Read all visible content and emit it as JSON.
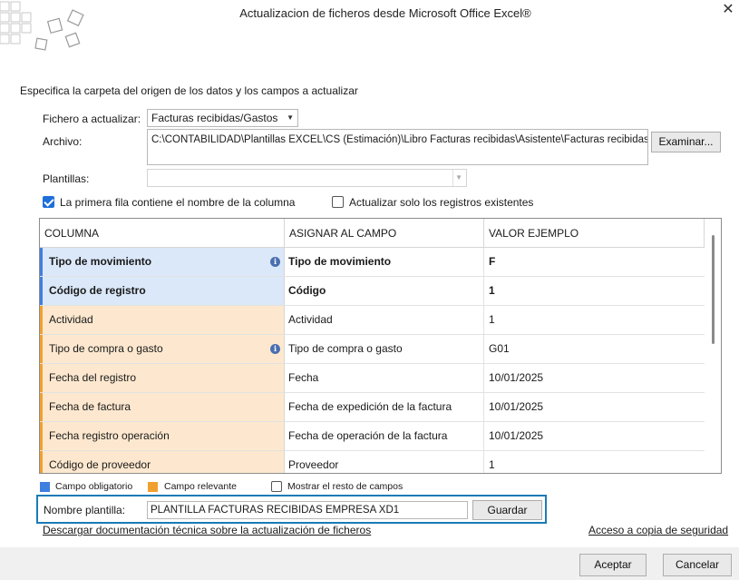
{
  "window": {
    "title": "Actualizacion de ficheros desde Microsoft Office Excel®",
    "close_icon": "close-icon"
  },
  "header": {
    "instruction": "Especifica la carpeta del origen de los datos y los campos a actualizar"
  },
  "form": {
    "fichero_label": "Fichero a actualizar:",
    "fichero_value": "Facturas recibidas/Gastos",
    "archivo_label": "Archivo:",
    "archivo_value": "C:\\CONTABILIDAD\\Plantillas EXCEL\\CS (Estimación)\\Libro Facturas recibidas\\Asistente\\Facturas recibidas asis",
    "examinar_label": "Examinar...",
    "plantillas_label": "Plantillas:",
    "plantillas_value": "",
    "primera_fila_label": "La primera fila contiene el nombre de la columna",
    "primera_fila_checked": true,
    "actualizar_label": "Actualizar solo los registros existentes",
    "actualizar_checked": false
  },
  "grid": {
    "headers": [
      "COLUMNA",
      "ASIGNAR AL CAMPO",
      "VALOR EJEMPLO"
    ],
    "rows": [
      {
        "columna": "Tipo de movimiento",
        "campo": "Tipo de movimiento",
        "valor": "F",
        "kind": "required",
        "info": true
      },
      {
        "columna": "Código de registro",
        "campo": "Código",
        "valor": "1",
        "kind": "required",
        "info": false
      },
      {
        "columna": "Actividad",
        "campo": "Actividad",
        "valor": "1",
        "kind": "relevant",
        "info": false
      },
      {
        "columna": "Tipo de compra o gasto",
        "campo": "Tipo de compra o gasto",
        "valor": "G01",
        "kind": "relevant",
        "info": true
      },
      {
        "columna": "Fecha del registro",
        "campo": "Fecha",
        "valor": "10/01/2025",
        "kind": "relevant",
        "info": false
      },
      {
        "columna": "Fecha de factura",
        "campo": "Fecha de expedición de la factura",
        "valor": "10/01/2025",
        "kind": "relevant",
        "info": false
      },
      {
        "columna": "Fecha registro operación",
        "campo": "Fecha de operación de la factura",
        "valor": "10/01/2025",
        "kind": "relevant",
        "info": false
      },
      {
        "columna": "Código de proveedor",
        "campo": "Proveedor",
        "valor": "1",
        "kind": "relevant",
        "info": false
      }
    ]
  },
  "legend": {
    "obligatorio_label": "Campo obligatorio",
    "obligatorio_color": "#3e7fe0",
    "relevante_label": "Campo relevante",
    "relevante_color": "#f0a030",
    "mostrar_label": "Mostrar el resto de campos",
    "mostrar_checked": false
  },
  "plantilla": {
    "label": "Nombre plantilla:",
    "value": "PLANTILLA FACTURAS RECIBIDAS EMPRESA XD1",
    "guardar_label": "Guardar"
  },
  "links": {
    "documentacion": "Descargar documentación técnica sobre la actualización de ficheros",
    "copia_seguridad": "Acceso a copia de seguridad"
  },
  "footer": {
    "aceptar_label": "Aceptar",
    "cancelar_label": "Cancelar"
  }
}
